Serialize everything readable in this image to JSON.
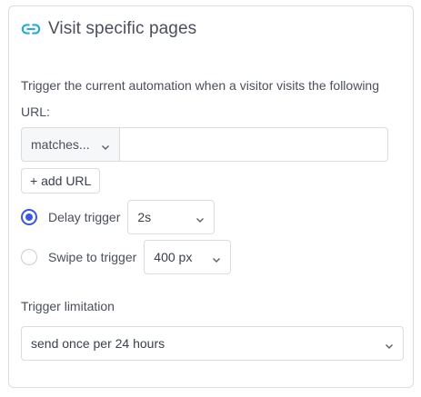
{
  "header": {
    "title": "Visit specific pages",
    "icon": "link-icon",
    "icon_color": "#2aa8d8"
  },
  "description": "Trigger the current automation when a visitor visits the following URL:",
  "url_rule": {
    "match_selected": "matches...",
    "url_value": "",
    "add_url_label": "+ add URL"
  },
  "trigger_options": [
    {
      "label": "Delay trigger",
      "checked": true,
      "select_value": "2s"
    },
    {
      "label": "Swipe to trigger",
      "checked": false,
      "select_value": "400 px"
    }
  ],
  "limitation": {
    "label": "Trigger limitation",
    "selected": "send once per 24 hours"
  },
  "colors": {
    "accent": "#3b5bdb",
    "border": "#d9dce1",
    "text": "#4a4f5a"
  }
}
